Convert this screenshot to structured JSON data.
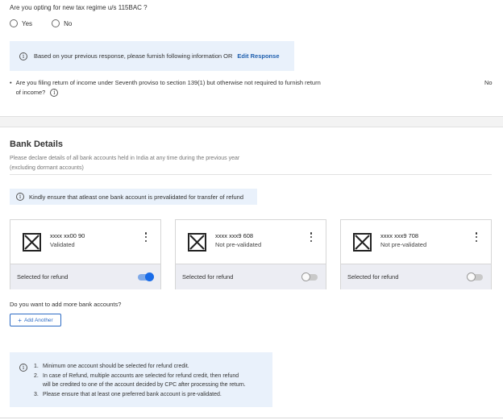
{
  "regime": {
    "question": "Are you opting for new tax regime u/s 115BAC ?",
    "options": [
      "Yes",
      "No"
    ]
  },
  "response_info": {
    "text": "Based on your previous response, please furnish following information OR",
    "link": "Edit Response"
  },
  "seventh_proviso": {
    "question_line1": "Are you filing return of income under Seventh proviso to section 139(1) but otherwise not required to furnish return",
    "question_line2": "of income?",
    "answer": "No"
  },
  "bank": {
    "title": "Bank Details",
    "description_line1": "Please declare details of all bank accounts held in India at any time during the previous year",
    "description_line2": "(excluding dormant accounts)",
    "prevalidate_note": "Kindly ensure that atleast one bank account is prevalidated for transfer of refund",
    "accounts": [
      {
        "number": "xxxx xx00 90",
        "status": "Validated",
        "refund_label": "Selected for refund",
        "selected": true
      },
      {
        "number": "xxxx xxx9 608",
        "status": "Not pre-validated",
        "refund_label": "Selected for refund",
        "selected": false
      },
      {
        "number": "xxxx xxx9 708",
        "status": "Not pre-validated",
        "refund_label": "Selected for refund",
        "selected": false
      }
    ],
    "add_more_question": "Do you want to add more bank accounts?",
    "add_button": "Add Another",
    "notes": [
      {
        "num": "1.",
        "text": "Minimum one account should be selected for refund credit."
      },
      {
        "num": "2.",
        "text": "In case of Refund, multiple accounts are selected for refund credit, then refund"
      },
      {
        "num": "",
        "text": "will be credited to one of the account decided by CPC after processing the return."
      },
      {
        "num": "3.",
        "text": "Please ensure that at least one preferred bank account is pre-validated."
      }
    ]
  },
  "colors": {
    "info_bg": "#e9f1fb",
    "link": "#1f5fae",
    "toggle_on": "#1a6ce8",
    "card_footer": "#ecedf3"
  }
}
